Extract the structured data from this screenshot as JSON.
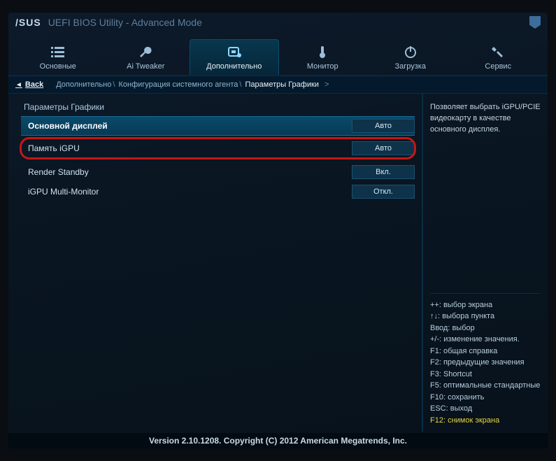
{
  "title": {
    "brand": "/SUS",
    "subtitle": "UEFI BIOS Utility - Advanced Mode"
  },
  "tabs": {
    "main": {
      "label": "Основные"
    },
    "tweaker": {
      "label": "Ai Tweaker"
    },
    "advanced": {
      "label": "Дополнительно"
    },
    "monitor": {
      "label": "Монитор"
    },
    "boot": {
      "label": "Загрузка"
    },
    "service": {
      "label": "Сервис"
    }
  },
  "back_label": "Back",
  "breadcrumb": {
    "seg1": "Дополнительно",
    "seg2": "Конфигурация системного агента",
    "seg3": "Параметры Графики"
  },
  "panel_title": "Параметры Графики",
  "settings": [
    {
      "label": "Основной дисплей",
      "value": "Авто"
    },
    {
      "label": "Память iGPU",
      "value": "Авто"
    },
    {
      "label": "Render Standby",
      "value": "Вкл."
    },
    {
      "label": "iGPU Multi-Monitor",
      "value": "Откл."
    }
  ],
  "help_text": "Позволяет выбрать iGPU/PCIE видеокарту в качестве основного дисплея.",
  "keys": {
    "arrows_lr": "++: выбор экрана",
    "arrows_ud": "↑↓: выбора пункта",
    "enter": "Ввод: выбор",
    "plusminus": "+/-: изменение значения.",
    "f1": "F1: общая справка",
    "f2": "F2: предыдущие значения",
    "f3": "F3: Shortcut",
    "f5": "F5: оптимальные стандартные",
    "f10": "F10: сохранить",
    "esc": "ESC: выход",
    "f12": "F12: снимок экрана"
  },
  "footer": "Version 2.10.1208. Copyright (C) 2012 American Megatrends, Inc."
}
